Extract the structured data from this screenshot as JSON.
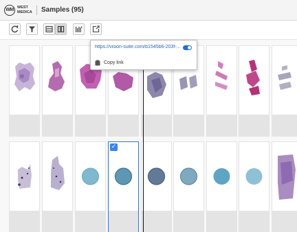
{
  "header": {
    "logo_text": "WM",
    "brand_line1": "WEST",
    "brand_line2": "MEDICA",
    "title": "Samples (95)"
  },
  "toolbar": {
    "buttons": [
      "refresh-icon",
      "filter-icon",
      "list-view-icon",
      "grid-view-icon",
      "barcode-icon",
      "export-icon"
    ],
    "active": "grid-view-icon"
  },
  "popup": {
    "url": "https://vision-suite.com/b1545b6-203f-...",
    "copy_label": "Copy link",
    "toggle_on": true
  },
  "samples": {
    "row1": [
      "tissue-lung",
      "tissue-lung",
      "tissue-lung",
      "tissue-lung",
      "tissue-lung",
      "tissue-lung",
      "tissue-strip",
      "tissue-strip",
      "tissue-fragments"
    ],
    "row2": [
      "tissue-biopsy",
      "tissue-biopsy",
      "cytology-circle",
      "cytology-circle",
      "cytology-circle",
      "cytology-circle",
      "cytology-circle",
      "cytology-circle",
      "tissue-large"
    ],
    "selected_index": 3
  },
  "colors": {
    "accent": "#3b82f6",
    "link": "#2864b4"
  }
}
